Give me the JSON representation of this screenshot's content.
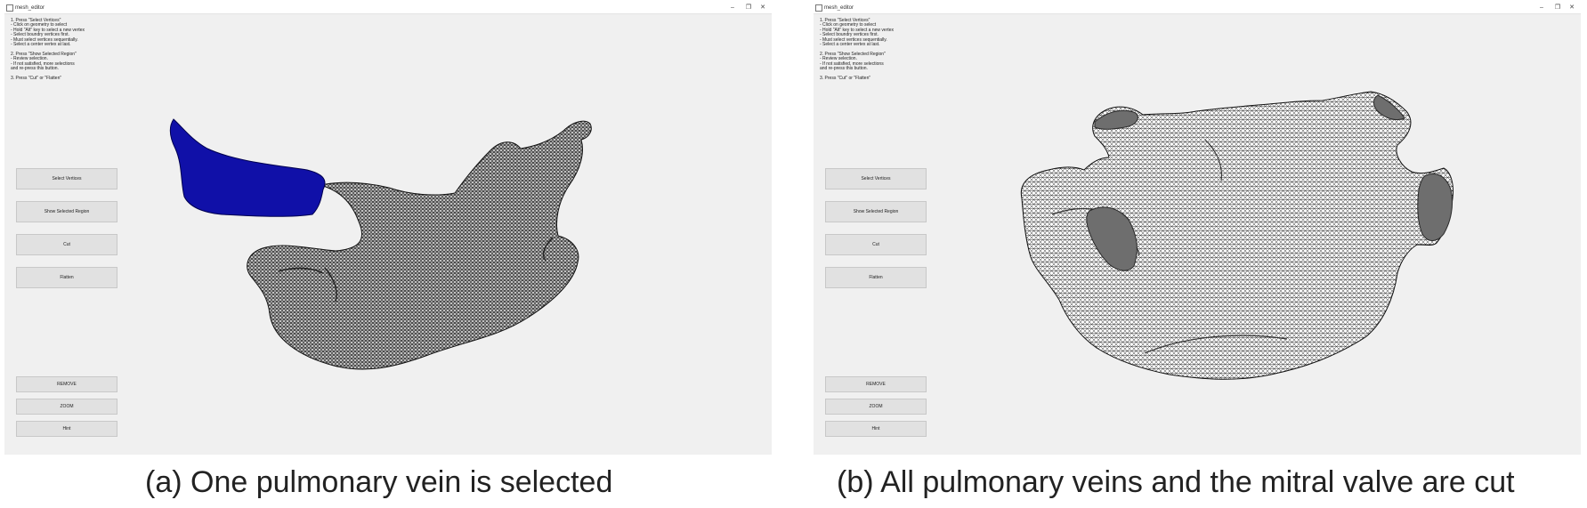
{
  "panels": [
    {
      "window_title": "mesh_editor",
      "window_controls": {
        "minimize": "–",
        "restore": "❐",
        "close": "✕"
      },
      "instructions": [
        "1. Press \"Select Vertices\"",
        " - Click on geometry to select",
        " - Hold \"Alt\" key to select a new vertex",
        " - Select boundry vertices first.",
        " - Must select vertices sequentially.",
        " - Select a center vertex at last.",
        "",
        "2. Press \"Show Selected Region\"",
        " - Review selection.",
        " - If not satisfied, more selections",
        "and re-press this button.",
        "",
        "3. Press \"Cut\" or \"Flatten\""
      ],
      "buttons": {
        "select_vertices": "Select Vertices",
        "show_selected_region": "Show Selected Region",
        "cut": "Cut",
        "flatten": "Flatten",
        "remove": "REMOVE",
        "zoom": "ZOOM",
        "hint": "Hint"
      },
      "caption": "(a) One pulmonary vein is selected",
      "colors": {
        "selected_region": "#1010a8",
        "mesh": "#c9c9c9",
        "mesh_line": "#1a1a1a"
      }
    },
    {
      "window_title": "mesh_editor",
      "window_controls": {
        "minimize": "–",
        "restore": "❐",
        "close": "✕"
      },
      "instructions": [
        "1. Press \"Select Vertices\"",
        " - Click on geometry to select",
        " - Hold \"Alt\" key to select a new vertex",
        " - Select boundry vertices first.",
        " - Must select vertices sequentially.",
        " - Select a center vertex at last.",
        "",
        "2. Press \"Show Selected Region\"",
        " - Review selection.",
        " - If not satisfied, more selections",
        "and re-press this button.",
        "",
        "3. Press \"Cut\" or \"Flatten\""
      ],
      "buttons": {
        "select_vertices": "Select Vertices",
        "show_selected_region": "Show Selected Region",
        "cut": "Cut",
        "flatten": "Flatten",
        "remove": "REMOVE",
        "zoom": "ZOOM",
        "hint": "Hint"
      },
      "caption": "(b) All pulmonary veins and the mitral valve are cut",
      "colors": {
        "cut_opening": "#707070",
        "mesh": "#f4f4f4",
        "mesh_line": "#1a1a1a"
      }
    }
  ]
}
